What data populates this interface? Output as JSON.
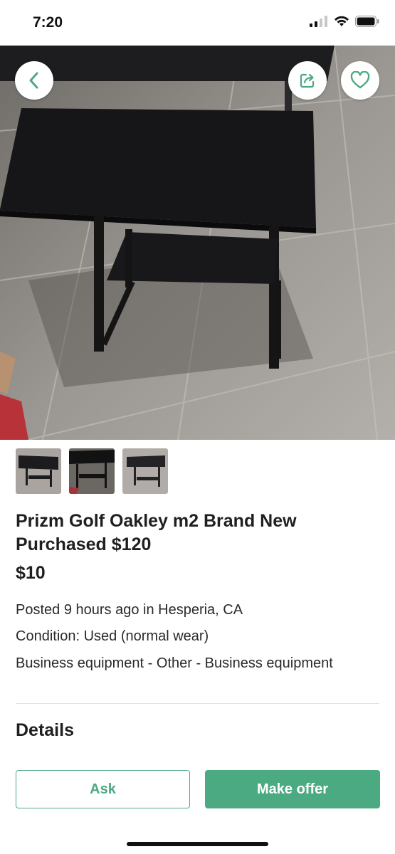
{
  "status_bar": {
    "time": "7:20"
  },
  "hero": {
    "image_desc_icon": "photo",
    "back_icon": "chevron-left-icon",
    "share_icon": "share-icon",
    "favorite_icon": "heart-icon"
  },
  "listing": {
    "title": "Prizm Golf Oakley m2 Brand New Purchased $120",
    "price": "$10",
    "posted": "Posted 9 hours ago in Hesperia, CA",
    "condition": "Condition: Used (normal wear)",
    "category": "Business equipment - Other - Business equipment"
  },
  "details_heading": "Details",
  "actions": {
    "ask_label": "Ask",
    "offer_label": "Make offer"
  },
  "colors": {
    "accent": "#4caa82"
  }
}
